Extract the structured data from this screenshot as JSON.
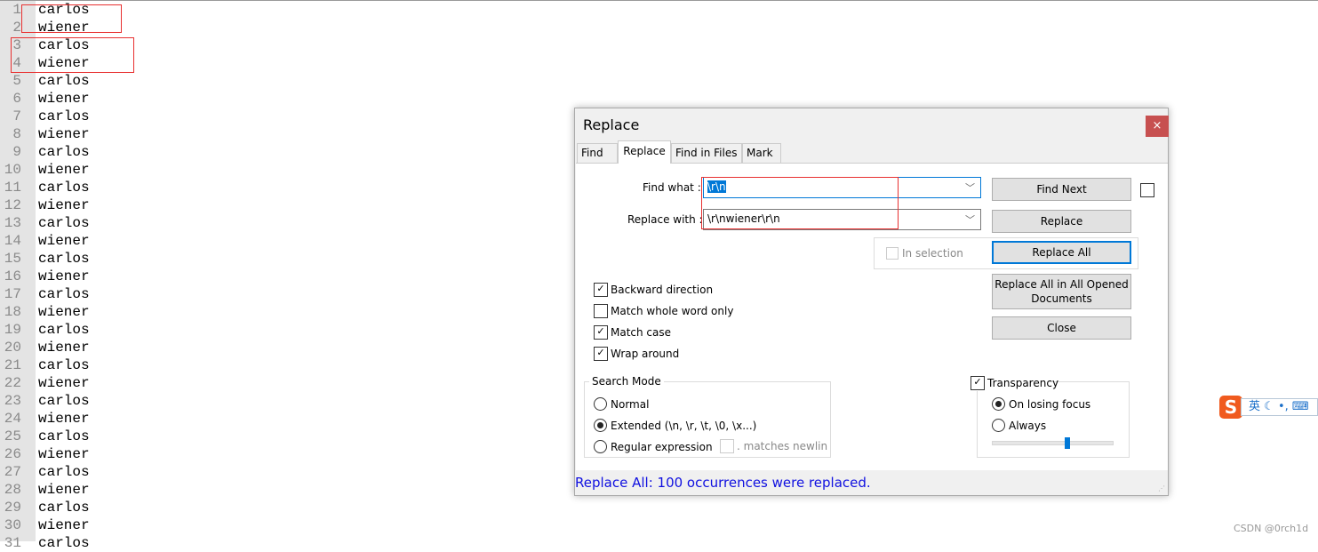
{
  "editor": {
    "lines": [
      {
        "n": "1",
        "t": "carlos"
      },
      {
        "n": "2",
        "t": "wiener"
      },
      {
        "n": "3",
        "t": "carlos"
      },
      {
        "n": "4",
        "t": "wiener"
      },
      {
        "n": "5",
        "t": "carlos"
      },
      {
        "n": "6",
        "t": "wiener"
      },
      {
        "n": "7",
        "t": "carlos"
      },
      {
        "n": "8",
        "t": "wiener"
      },
      {
        "n": "9",
        "t": "carlos"
      },
      {
        "n": "10",
        "t": "wiener"
      },
      {
        "n": "11",
        "t": "carlos"
      },
      {
        "n": "12",
        "t": "wiener"
      },
      {
        "n": "13",
        "t": "carlos"
      },
      {
        "n": "14",
        "t": "wiener"
      },
      {
        "n": "15",
        "t": "carlos"
      },
      {
        "n": "16",
        "t": "wiener"
      },
      {
        "n": "17",
        "t": "carlos"
      },
      {
        "n": "18",
        "t": "wiener"
      },
      {
        "n": "19",
        "t": "carlos"
      },
      {
        "n": "20",
        "t": "wiener"
      },
      {
        "n": "21",
        "t": "carlos"
      },
      {
        "n": "22",
        "t": "wiener"
      },
      {
        "n": "23",
        "t": "carlos"
      },
      {
        "n": "24",
        "t": "wiener"
      },
      {
        "n": "25",
        "t": "carlos"
      },
      {
        "n": "26",
        "t": "wiener"
      },
      {
        "n": "27",
        "t": "carlos"
      },
      {
        "n": "28",
        "t": "wiener"
      },
      {
        "n": "29",
        "t": "carlos"
      },
      {
        "n": "30",
        "t": "wiener"
      },
      {
        "n": "31",
        "t": "carlos"
      }
    ]
  },
  "dialog": {
    "title": "Replace",
    "close": "×",
    "tabs": [
      "Find",
      "Replace",
      "Find in Files",
      "Mark"
    ],
    "find_label": "Find what :",
    "find_value": "\\r\\n",
    "replace_label": "Replace with :",
    "replace_value": "\\r\\nwiener\\r\\n",
    "buttons": {
      "find_next": "Find Next",
      "replace": "Replace",
      "replace_all": "Replace All",
      "replace_all_opened": "Replace All in All Opened Documents",
      "close": "Close"
    },
    "in_selection": "In selection",
    "options": [
      {
        "label": "Backward direction",
        "checked": true
      },
      {
        "label": "Match whole word only",
        "checked": false
      },
      {
        "label": "Match case",
        "checked": true
      },
      {
        "label": "Wrap around",
        "checked": true
      }
    ],
    "search_mode": {
      "title": "Search Mode",
      "normal": "Normal",
      "extended": "Extended (\\n, \\r, \\t, \\0, \\x...)",
      "regex": "Regular expression",
      "matches_newline": ". matches newline",
      "selected": "extended"
    },
    "transparency": {
      "label": "Transparency",
      "checked": true,
      "on_losing_focus": "On losing focus",
      "always": "Always",
      "selected": "on_losing_focus",
      "level": 0.62
    },
    "status": "Replace All: 100 occurrences were replaced."
  },
  "ime": {
    "lang": "英"
  },
  "watermark": "CSDN @0rch1d",
  "colors": {
    "accent": "#0078d7",
    "status": "#1010e0",
    "annotation": "#e83030",
    "close": "#c75050"
  }
}
